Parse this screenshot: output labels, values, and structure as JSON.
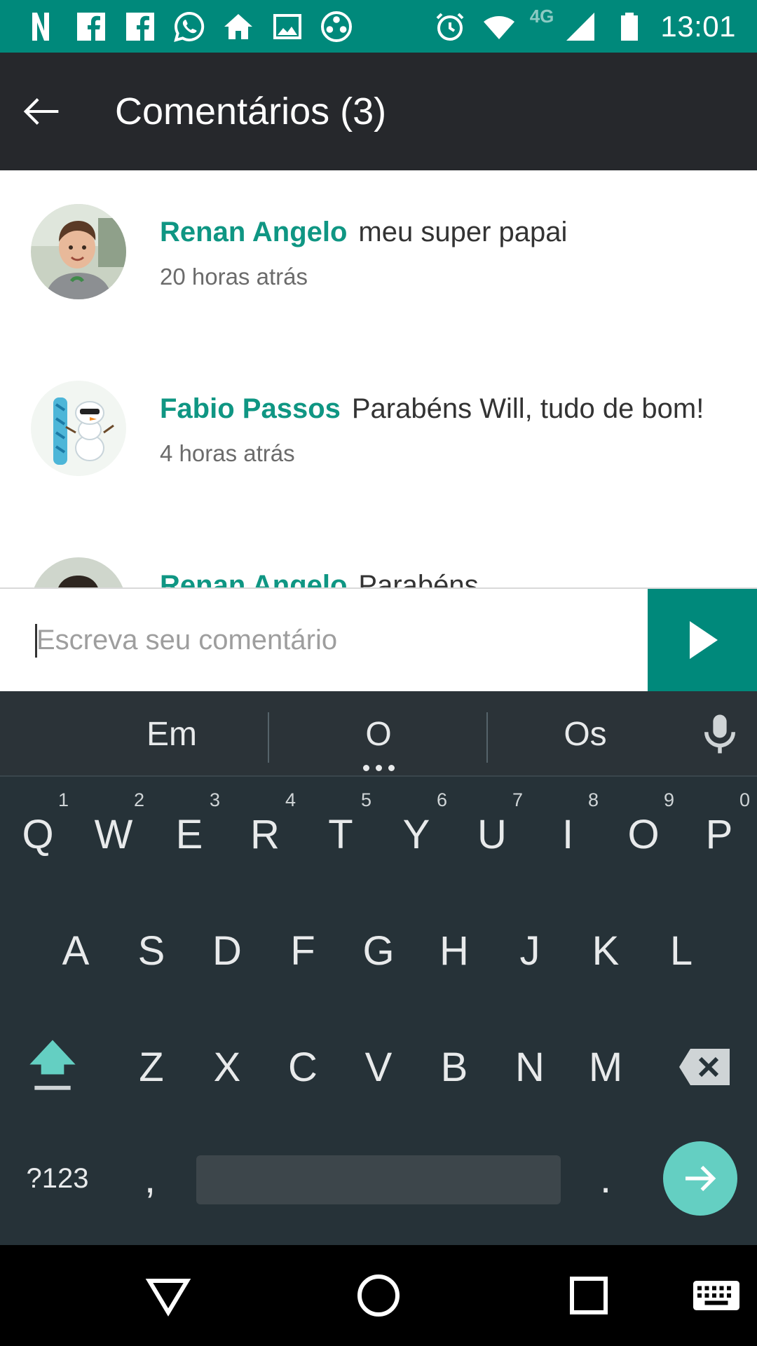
{
  "status_bar": {
    "time": "13:01",
    "network": "4G",
    "notification_icons": [
      "netflix-icon",
      "facebook-icon",
      "facebook-icon",
      "whatsapp-icon",
      "home-icon",
      "gallery-icon",
      "film-reel-icon"
    ],
    "system_icons": [
      "alarm-icon",
      "wifi-icon",
      "signal-icon",
      "battery-icon"
    ],
    "background_color": "#00897b"
  },
  "toolbar": {
    "title": "Comentários (3)",
    "background_color": "#26282c"
  },
  "comments": [
    {
      "author": "Renan Angelo",
      "text": "meu super papai",
      "time": "20 horas atrás"
    },
    {
      "author": "Fabio Passos",
      "text": "Parabéns Will, tudo de bom!",
      "time": "4 horas atrás"
    },
    {
      "author": "Renan Angelo",
      "text": "Parabéns",
      "time": ""
    }
  ],
  "composer": {
    "placeholder": "Escreva seu comentário",
    "value": "",
    "accent_color": "#00897b"
  },
  "keyboard": {
    "suggestions": [
      "Em",
      "O",
      "Os"
    ],
    "row1": [
      "Q",
      "W",
      "E",
      "R",
      "T",
      "Y",
      "U",
      "I",
      "O",
      "P"
    ],
    "row1_numbers": [
      "1",
      "2",
      "3",
      "4",
      "5",
      "6",
      "7",
      "8",
      "9",
      "0"
    ],
    "row2": [
      "A",
      "S",
      "D",
      "F",
      "G",
      "H",
      "J",
      "K",
      "L"
    ],
    "row3": [
      "Z",
      "X",
      "C",
      "V",
      "B",
      "N",
      "M"
    ],
    "symbols_label": "?123",
    "comma": ",",
    "period": "."
  }
}
